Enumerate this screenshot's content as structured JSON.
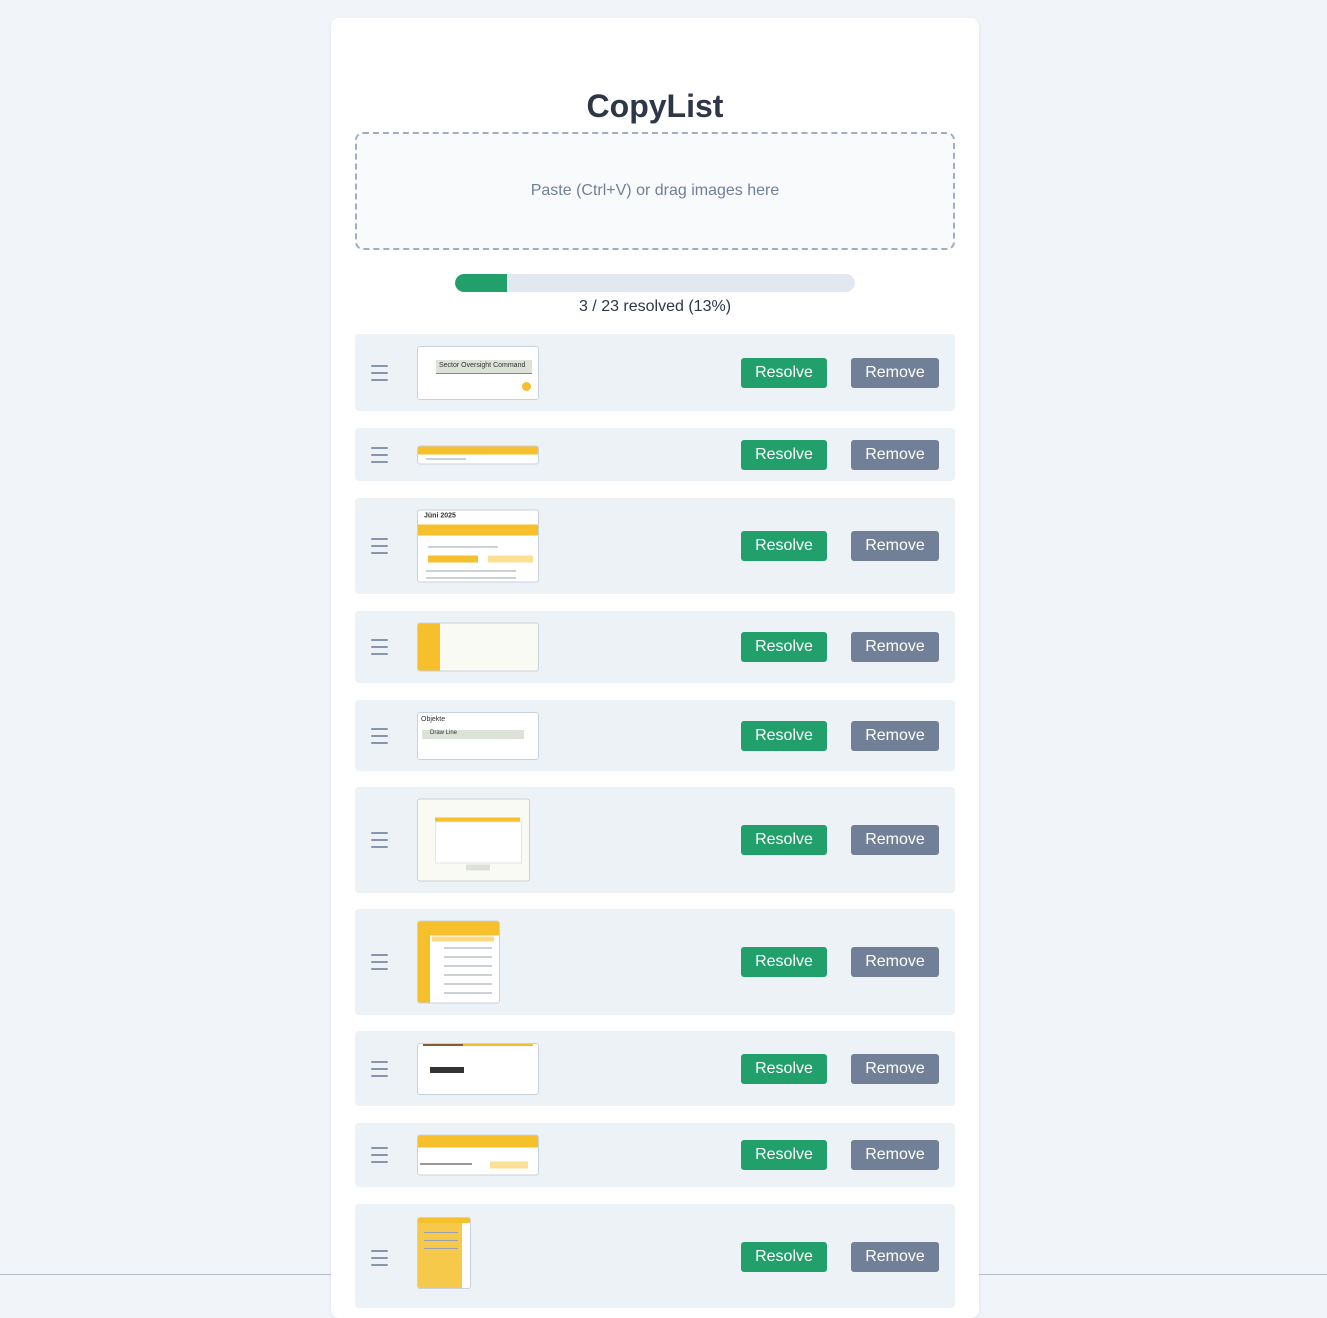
{
  "app": {
    "title": "CopyList"
  },
  "dropzone": {
    "text": "Paste (Ctrl+V) or drag images here"
  },
  "progress": {
    "resolved": 3,
    "total": 23,
    "percent": 13,
    "text": "3 / 23 resolved (13%)"
  },
  "items": [
    {
      "resolve_label": "Resolve",
      "remove_label": "Remove",
      "thumb_text": "Sector Oversight Command"
    },
    {
      "resolve_label": "Resolve",
      "remove_label": "Remove"
    },
    {
      "resolve_label": "Resolve",
      "remove_label": "Remove",
      "thumb_text": "Jüni 2025"
    },
    {
      "resolve_label": "Resolve",
      "remove_label": "Remove"
    },
    {
      "resolve_label": "Resolve",
      "remove_label": "Remove",
      "thumb_text": "Objekte",
      "thumb_text2": "Draw Line"
    },
    {
      "resolve_label": "Resolve",
      "remove_label": "Remove"
    },
    {
      "resolve_label": "Resolve",
      "remove_label": "Remove"
    },
    {
      "resolve_label": "Resolve",
      "remove_label": "Remove"
    },
    {
      "resolve_label": "Resolve",
      "remove_label": "Remove"
    },
    {
      "resolve_label": "Resolve",
      "remove_label": "Remove"
    }
  ],
  "colors": {
    "accent": "#22a06b",
    "remove": "#718096",
    "thumb_accent": "#f6bf2c"
  }
}
